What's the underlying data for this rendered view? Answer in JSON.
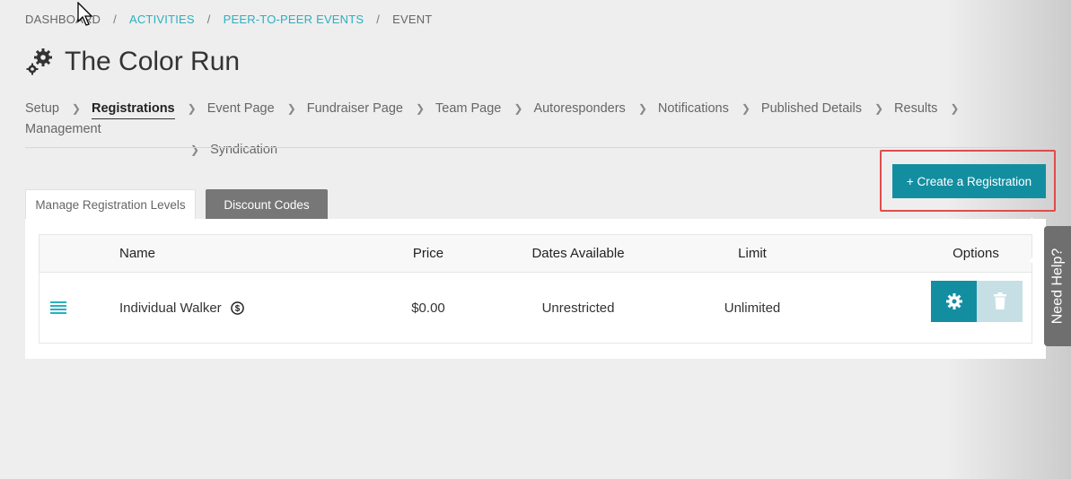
{
  "breadcrumb": {
    "items": [
      "DASHBOARD",
      "ACTIVITIES",
      "PEER-TO-PEER EVENTS",
      "EVENT"
    ],
    "separator": "/"
  },
  "page": {
    "title": "The Color Run",
    "icon": "gear-icon"
  },
  "steps": {
    "items": [
      "Setup",
      "Registrations",
      "Event Page",
      "Fundraiser Page",
      "Team Page",
      "Autoresponders",
      "Notifications",
      "Published Details",
      "Results",
      "Management",
      "Syndication"
    ],
    "active": "Registrations"
  },
  "actions": {
    "create_label": "+ Create a Registration"
  },
  "tabs": {
    "manage": "Manage Registration Levels",
    "discount": "Discount Codes"
  },
  "table": {
    "headers": {
      "name": "Name",
      "price": "Price",
      "dates": "Dates Available",
      "limit": "Limit",
      "options": "Options"
    },
    "rows": [
      {
        "name": "Individual Walker",
        "price": "$0.00",
        "dates": "Unrestricted",
        "limit": "Unlimited"
      }
    ]
  },
  "help": {
    "label": "Need Help?"
  },
  "colors": {
    "accent": "#138ea0",
    "link": "#2ab0c0",
    "highlight": "#e04c4c"
  }
}
